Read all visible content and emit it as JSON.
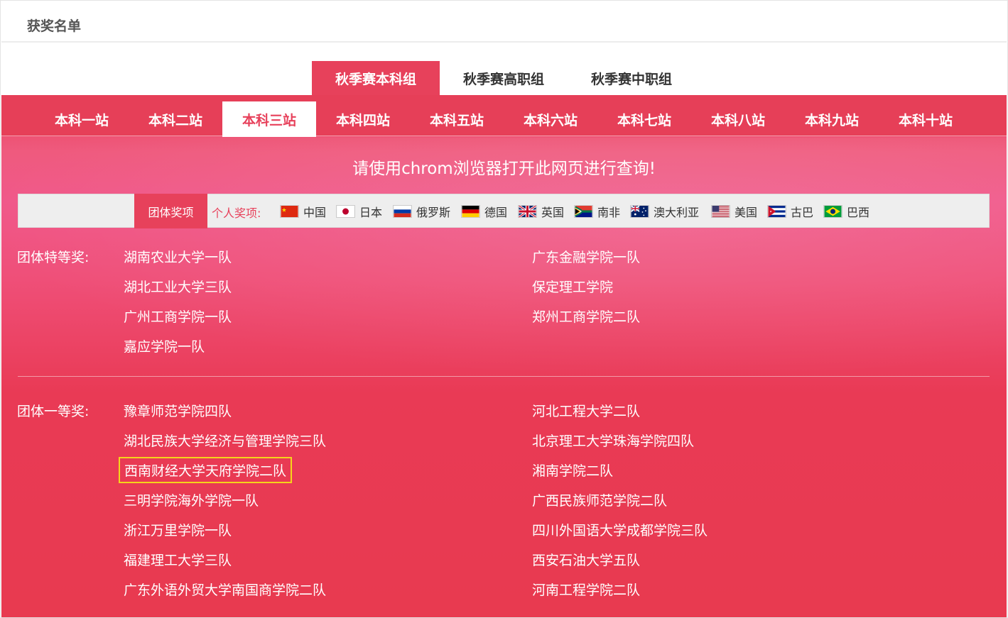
{
  "header": {
    "title": "获奖名单"
  },
  "group_tabs": [
    {
      "label": "秋季赛本科组",
      "active": true
    },
    {
      "label": "秋季赛高职组",
      "active": false
    },
    {
      "label": "秋季赛中职组",
      "active": false
    }
  ],
  "station_tabs": [
    {
      "label": "本科一站",
      "active": false
    },
    {
      "label": "本科二站",
      "active": false
    },
    {
      "label": "本科三站",
      "active": true
    },
    {
      "label": "本科四站",
      "active": false
    },
    {
      "label": "本科五站",
      "active": false
    },
    {
      "label": "本科六站",
      "active": false
    },
    {
      "label": "本科七站",
      "active": false
    },
    {
      "label": "本科八站",
      "active": false
    },
    {
      "label": "本科九站",
      "active": false
    },
    {
      "label": "本科十站",
      "active": false
    }
  ],
  "notice": "请使用chrom浏览器打开此网页进行查询!",
  "award_filter": {
    "team_award_label": "团体奖项",
    "individual_label": "个人奖项:",
    "countries": [
      {
        "name": "中国",
        "flag": "china-flag-icon"
      },
      {
        "name": "日本",
        "flag": "japan-flag-icon"
      },
      {
        "name": "俄罗斯",
        "flag": "russia-flag-icon"
      },
      {
        "name": "德国",
        "flag": "germany-flag-icon"
      },
      {
        "name": "英国",
        "flag": "uk-flag-icon"
      },
      {
        "name": "南非",
        "flag": "south-africa-flag-icon"
      },
      {
        "name": "澳大利亚",
        "flag": "australia-flag-icon"
      },
      {
        "name": "美国",
        "flag": "usa-flag-icon"
      },
      {
        "name": "古巴",
        "flag": "cuba-flag-icon"
      },
      {
        "name": "巴西",
        "flag": "brazil-flag-icon"
      }
    ]
  },
  "prizes": [
    {
      "label": "团体特等奖:",
      "left": [
        "湖南农业大学一队",
        "湖北工业大学三队",
        "广州工商学院一队",
        "嘉应学院一队"
      ],
      "right": [
        "广东金融学院一队",
        "保定理工学院",
        "郑州工商学院二队"
      ]
    },
    {
      "label": "团体一等奖:",
      "left": [
        "豫章师范学院四队",
        "湖北民族大学经济与管理学院三队",
        "西南财经大学天府学院二队",
        "三明学院海外学院一队",
        "浙江万里学院一队",
        "福建理工大学三队",
        "广东外语外贸大学南国商学院二队"
      ],
      "right": [
        "河北工程大学二队",
        "北京理工大学珠海学院四队",
        "湘南学院二队",
        "广西民族师范学院二队",
        "四川外国语大学成都学院三队",
        "西安石油大学五队",
        "河南工程学院二队"
      ],
      "highlighted": "西南财经大学天府学院二队"
    }
  ],
  "colors": {
    "accent": "#e7415b",
    "highlight_border": "#f5d41b",
    "panel_text": "#ffffff"
  }
}
